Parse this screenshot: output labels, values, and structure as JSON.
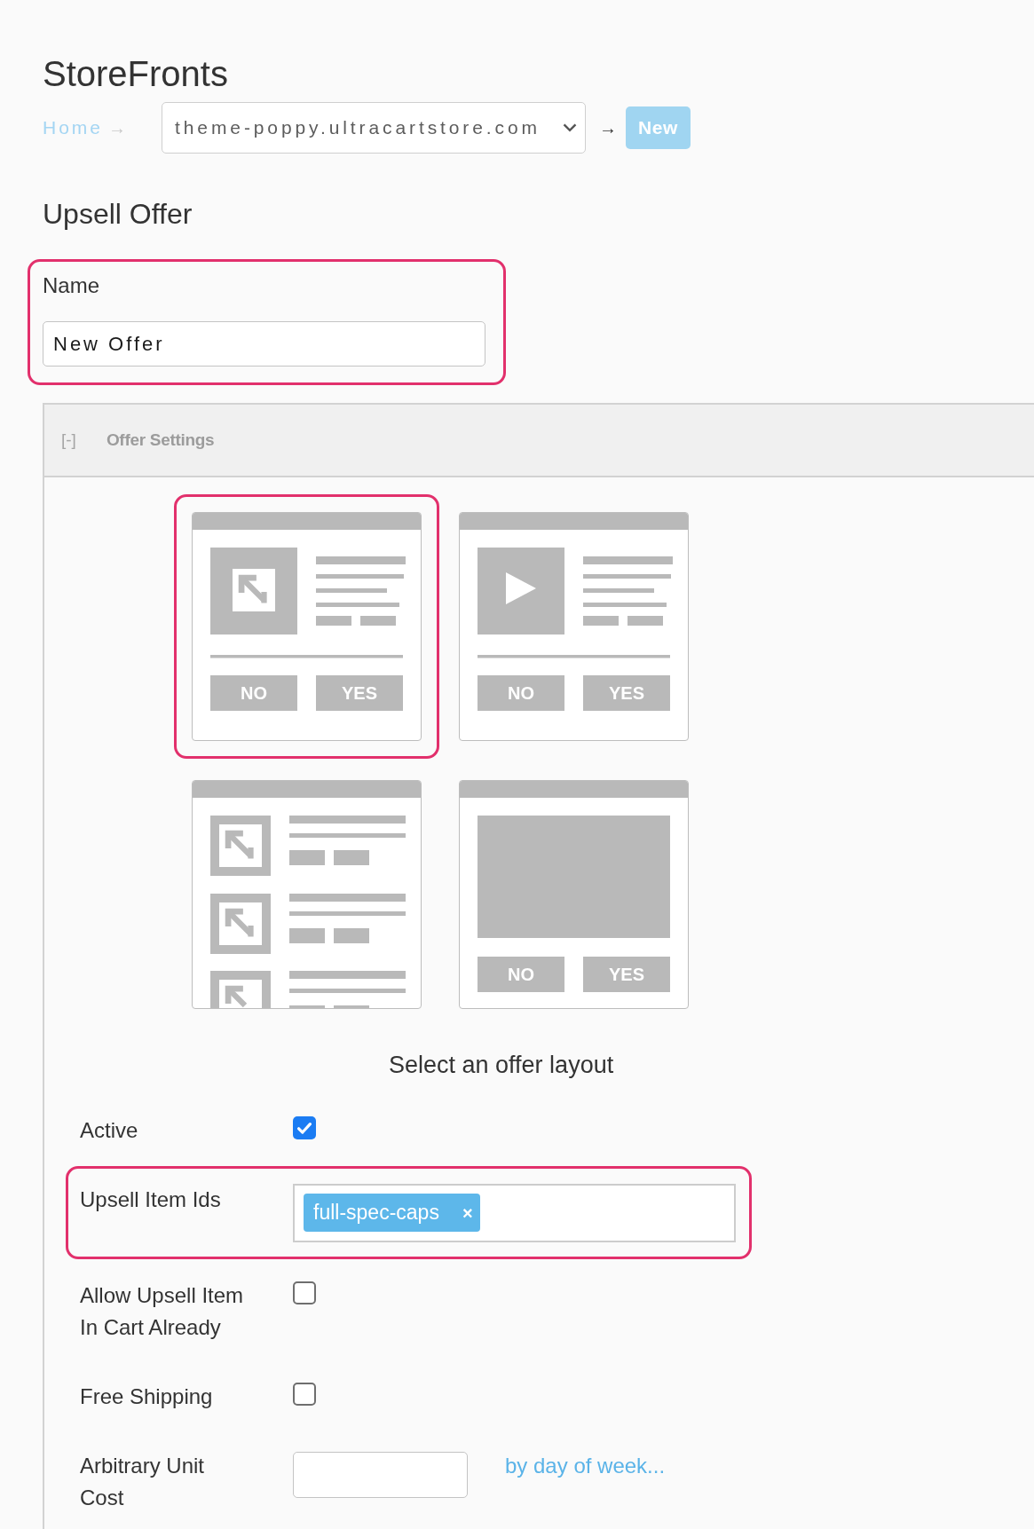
{
  "page_title": "StoreFronts",
  "breadcrumb": {
    "home": "Home",
    "home_separator": "→",
    "store_select": {
      "value": "theme-poppy.ultracartstore.com"
    },
    "separator": "→",
    "current": "New"
  },
  "section_title": "Upsell Offer",
  "name_field": {
    "label": "Name",
    "value": "New Offer",
    "highlighted": true
  },
  "panel": {
    "toggle": "[-]",
    "title": "Offer Settings"
  },
  "layouts": [
    {
      "kind": "image",
      "selected": true,
      "buttons": [
        "NO",
        "YES"
      ]
    },
    {
      "kind": "video",
      "selected": false,
      "buttons": [
        "NO",
        "YES"
      ]
    },
    {
      "kind": "list",
      "selected": false
    },
    {
      "kind": "banner",
      "selected": false,
      "buttons": [
        "NO",
        "YES"
      ]
    }
  ],
  "layout_caption": "Select an offer layout",
  "fields": [
    {
      "kind": "checkbox",
      "label": "Active",
      "checked": true,
      "highlighted": false
    },
    {
      "kind": "tags",
      "label": "Upsell Item Ids",
      "highlighted": true,
      "tags": [
        {
          "text": "full-spec-caps",
          "remove": "×"
        }
      ]
    },
    {
      "kind": "checkbox",
      "label": "Allow Upsell Item In Cart Already",
      "checked": false,
      "highlighted": false
    },
    {
      "kind": "checkbox",
      "label": "Free Shipping",
      "checked": false,
      "highlighted": false
    },
    {
      "kind": "text",
      "label": "Arbitrary Unit Cost",
      "highlighted": false,
      "link": "by day of week..."
    }
  ]
}
